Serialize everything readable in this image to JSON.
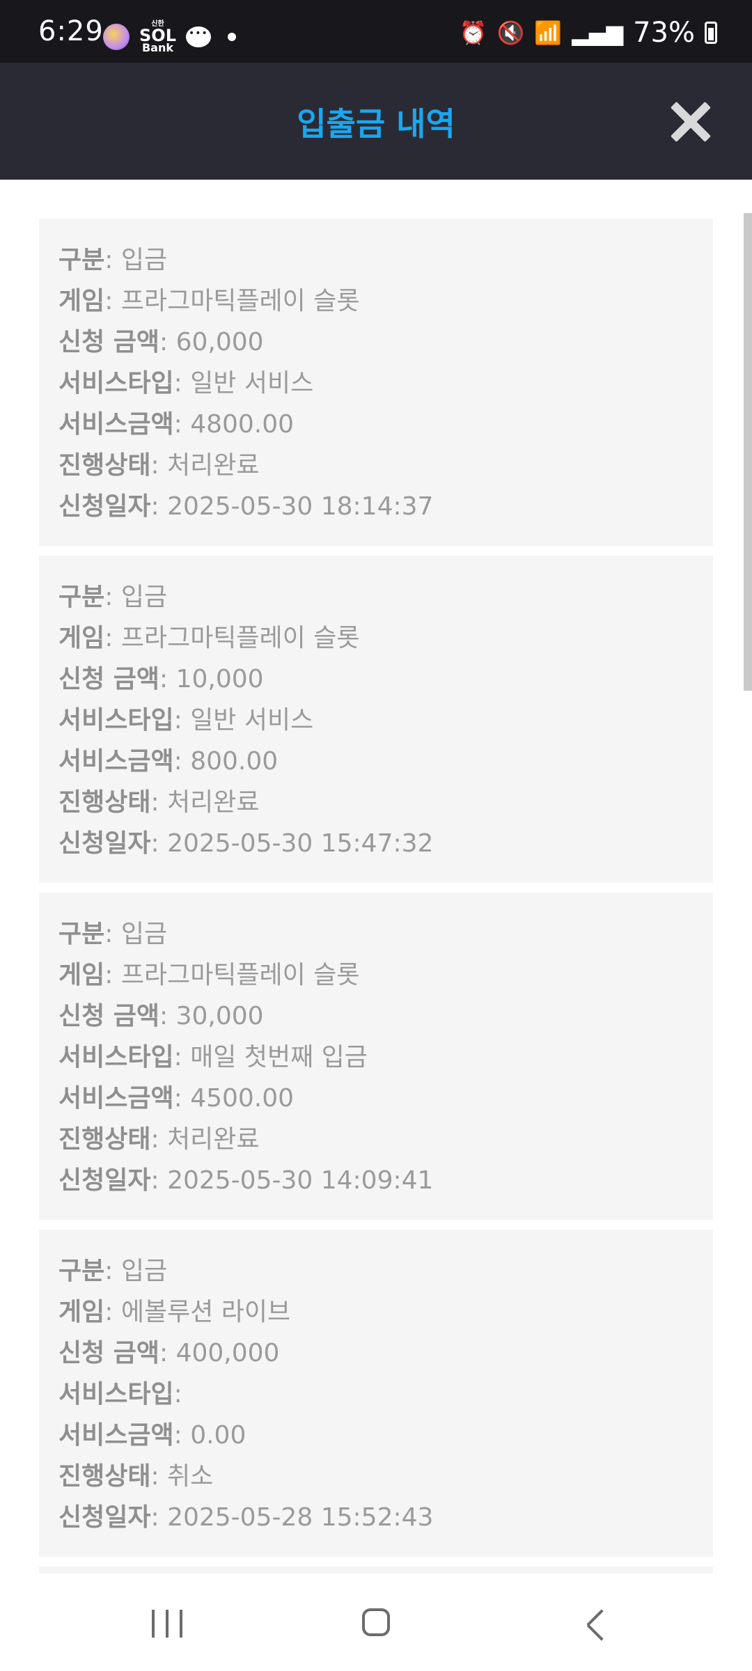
{
  "status_bar": {
    "time": "6:29",
    "bank_small": "신한",
    "bank_big": "SOL",
    "bank_label": "Bank",
    "battery": "73%",
    "icons": [
      "alarm-icon",
      "mute-icon",
      "wifi-icon",
      "signal-icon",
      "battery-icon"
    ]
  },
  "header": {
    "title": "입출금 내역",
    "title_color": "#1aa7ee",
    "close_icon": "close-icon"
  },
  "labels": {
    "type": "구분",
    "game": "게임",
    "amount": "신청 금액",
    "service_type": "서비스타입",
    "service_amount": "서비스금액",
    "status": "진행상태",
    "date": "신청일자"
  },
  "transactions": [
    {
      "type": "입금",
      "game": "프라그마틱플레이 슬롯",
      "amount": "60,000",
      "service_type": "일반 서비스",
      "service_amount": "4800.00",
      "status": "처리완료",
      "date": "2025-05-30 18:14:37"
    },
    {
      "type": "입금",
      "game": "프라그마틱플레이 슬롯",
      "amount": "10,000",
      "service_type": "일반 서비스",
      "service_amount": "800.00",
      "status": "처리완료",
      "date": "2025-05-30 15:47:32"
    },
    {
      "type": "입금",
      "game": "프라그마틱플레이 슬롯",
      "amount": "30,000",
      "service_type": "매일 첫번째 입금",
      "service_amount": "4500.00",
      "status": "처리완료",
      "date": "2025-05-30 14:09:41"
    },
    {
      "type": "입금",
      "game": "에볼루션 라이브",
      "amount": "400,000",
      "service_type": "",
      "service_amount": "0.00",
      "status": "취소",
      "date": "2025-05-28 15:52:43"
    }
  ],
  "nav": {
    "recent_icon": "recent-apps-icon",
    "home_icon": "home-icon",
    "back_icon": "back-icon"
  }
}
